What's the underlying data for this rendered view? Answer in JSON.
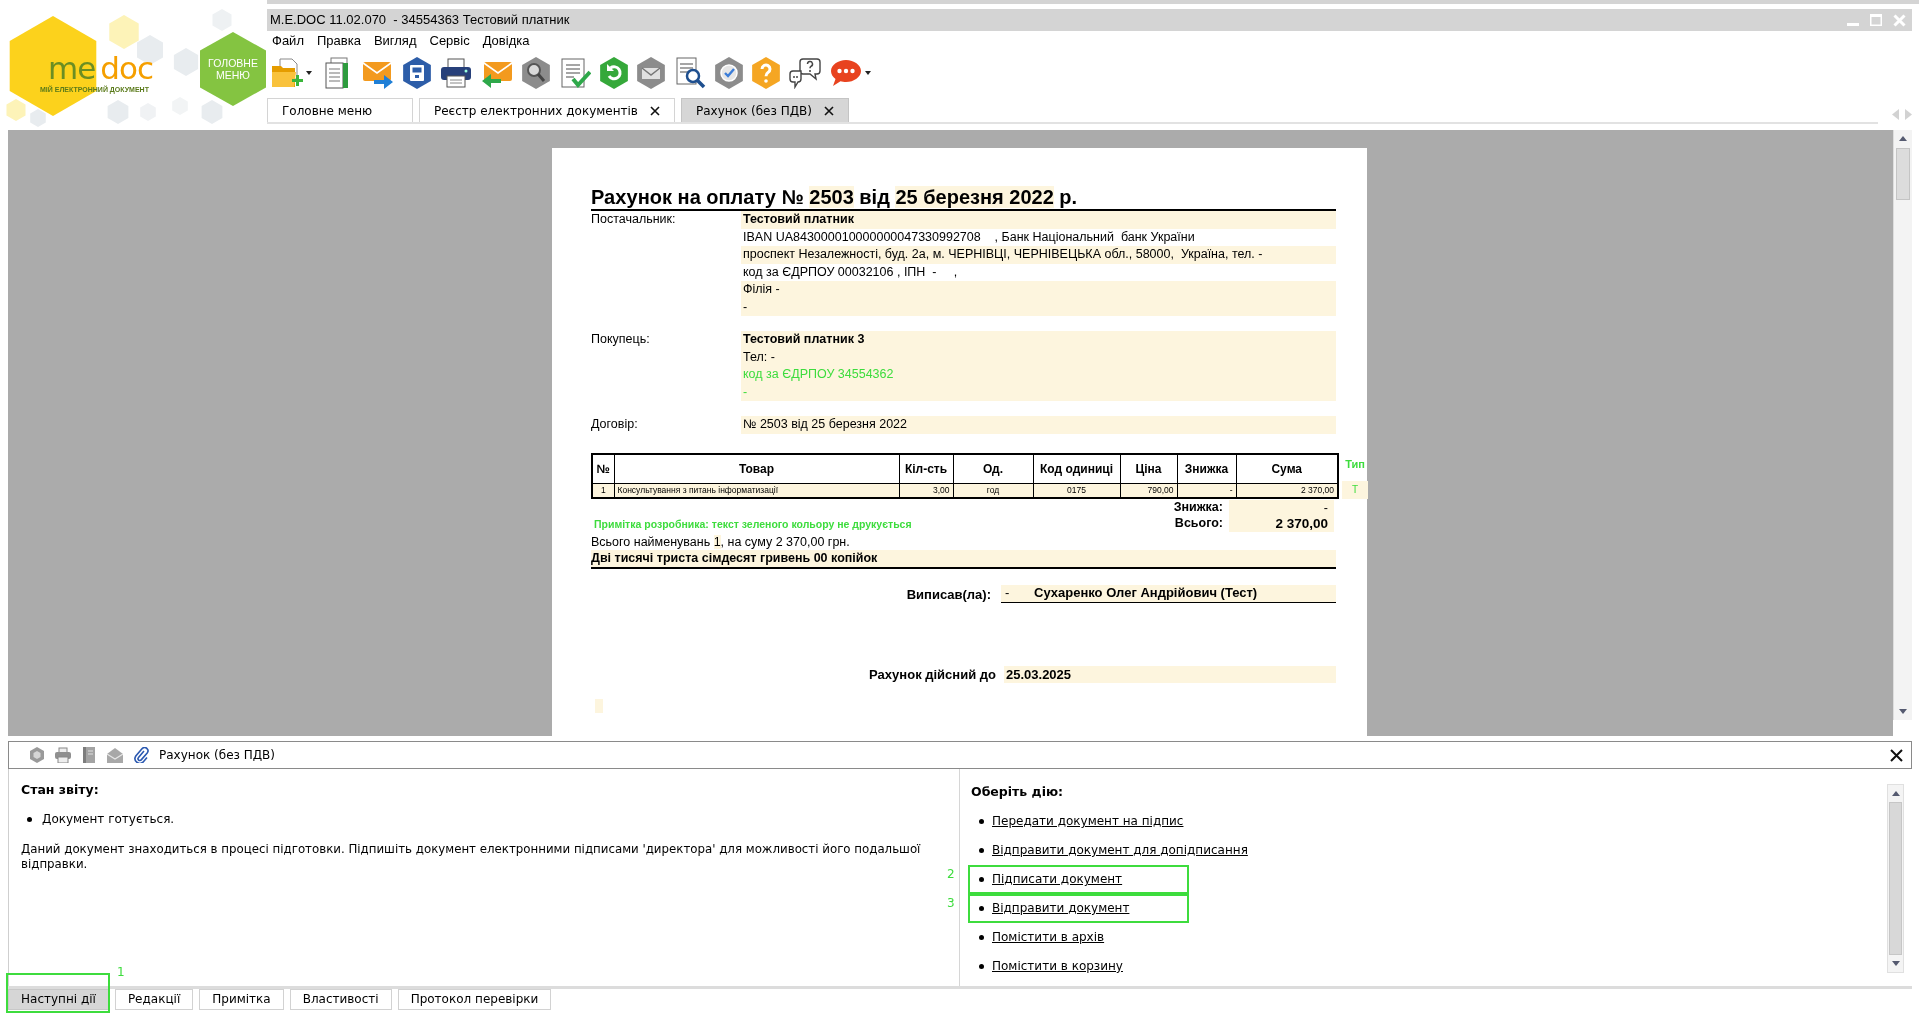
{
  "logo": {
    "wordmark": [
      "me",
      "doc"
    ],
    "tagline": "МІЙ ЕЛЕКТРОННИЙ ДОКУМЕНТ"
  },
  "main_menu_button": {
    "label": "ГОЛОВНЕ МЕНЮ"
  },
  "window": {
    "title": "M.E.DOC 11.02.070  - 34554363 Тестовий платник"
  },
  "menu": [
    "Файл",
    "Правка",
    "Вигляд",
    "Сервіс",
    "Довідка"
  ],
  "tabs": [
    {
      "label": "Головне меню",
      "selected": false,
      "closable": false
    },
    {
      "label": "Реєстр електронних документів",
      "selected": false,
      "closable": true
    },
    {
      "label": "Рахунок (без ПДВ)",
      "selected": true,
      "closable": true
    }
  ],
  "document": {
    "title": [
      {
        "text": "Рахунок на оплату № ",
        "field": false
      },
      {
        "text": "2503",
        "field": true
      },
      {
        "text": " від ",
        "field": false
      },
      {
        "text": "25 березня 2022",
        "field": true
      },
      {
        "text": " р.",
        "field": false
      }
    ],
    "parties": [
      {
        "label": "Постачальник:",
        "lines": [
          {
            "kind": "name",
            "text": "Тестовий платник",
            "field": true
          },
          {
            "kind": "text",
            "text": "IBAN UA843000010000000047330992708    , Банк Національний  банк України",
            "field": false
          },
          {
            "kind": "text",
            "text": "проспект Незалежності, буд. 2а, м. ЧЕРНІВЦІ, ЧЕРНІВЕЦЬКА обл., 58000,  Україна, тел. -",
            "field": true
          },
          {
            "kind": "text",
            "text": "код за ЄДРПОУ 00032106 , ІПН  -     ,",
            "field": false
          },
          {
            "kind": "text",
            "text": "Філія -",
            "field": true
          },
          {
            "kind": "text",
            "text": "-",
            "field": true
          }
        ]
      },
      {
        "label": "Покупець:",
        "lines": [
          {
            "kind": "name",
            "text": "Тестовий платник 3",
            "field": true
          },
          {
            "kind": "text",
            "text": "Тел: -",
            "field": true
          },
          {
            "kind": "note",
            "text": "код за ЄДРПОУ 34554362",
            "field": true
          },
          {
            "kind": "note",
            "text": "-",
            "field": true
          }
        ]
      },
      {
        "label": "Договір:",
        "lines": [
          {
            "kind": "text",
            "text": "№ 2503 від 25 березня 2022",
            "field": true
          }
        ]
      }
    ],
    "table": {
      "columns": [
        "№",
        "Товар",
        "Кіл-сть",
        "Од.",
        "Код одиниці",
        "Ціна",
        "Знижка",
        "Сума"
      ],
      "rows": [
        [
          "1",
          "Консультування з питань інформатизації",
          "3,00",
          "год",
          "0175",
          "790,00",
          "-",
          "2 370,00"
        ]
      ]
    },
    "type_column": {
      "header": "Тип",
      "values": [
        "Т"
      ]
    },
    "developer_note": "Примітка розробника: текст зеленого кольору не друкується",
    "totals": [
      {
        "kind": "discount",
        "label": "Знижка:",
        "value": "-"
      },
      {
        "kind": "total",
        "label": "Всього:",
        "value": "2 370,00"
      }
    ],
    "summary": [
      {
        "text": "Всього найменувань ",
        "field": false
      },
      {
        "text": "1",
        "field": true
      },
      {
        "text": ", на суму 2 370,00 ",
        "field": false
      },
      {
        "text": "грн.",
        "field": false
      }
    ],
    "amount_in_words": "Дві тисячі триста сімдесят гривень 00 копійок",
    "signed_by": {
      "label": "Виписав(ла):",
      "position": "-",
      "name": "Сухаренко Олег Андрійович (Тест)"
    },
    "valid_until": {
      "label": "Рахунок дійсний до",
      "value": "25.03.2025"
    }
  },
  "details_panel": {
    "title": "Рахунок (без ПДВ)",
    "status": {
      "heading": "Стан звіту:",
      "items": [
        "Документ готується."
      ],
      "description": "Даний документ знаходиться в процесі підготовки. Підпишіть документ електронними підписами 'директора' для можливості його подальшої відправки."
    },
    "actions": {
      "heading": "Оберіть дію:",
      "items": [
        {
          "label": "Передати документ на підпис",
          "highlighted": false
        },
        {
          "label": "Відправити документ для допідписання",
          "highlighted": false
        },
        {
          "label": "Підписати документ",
          "highlighted": true,
          "callout": "2"
        },
        {
          "label": "Відправити документ",
          "highlighted": true,
          "callout": "3"
        },
        {
          "label": "Помістити в архів",
          "highlighted": false
        },
        {
          "label": "Помістити в корзину",
          "highlighted": false
        }
      ]
    },
    "tabs": [
      {
        "label": "Наступні дії",
        "selected": true,
        "highlighted": true,
        "callout": "1"
      },
      {
        "label": "Редакції",
        "selected": false,
        "highlighted": false
      },
      {
        "label": "Примітка",
        "selected": false,
        "highlighted": false
      },
      {
        "label": "Властивості",
        "selected": false,
        "highlighted": false
      },
      {
        "label": "Протокол перевірки",
        "selected": false,
        "highlighted": false
      }
    ]
  }
}
